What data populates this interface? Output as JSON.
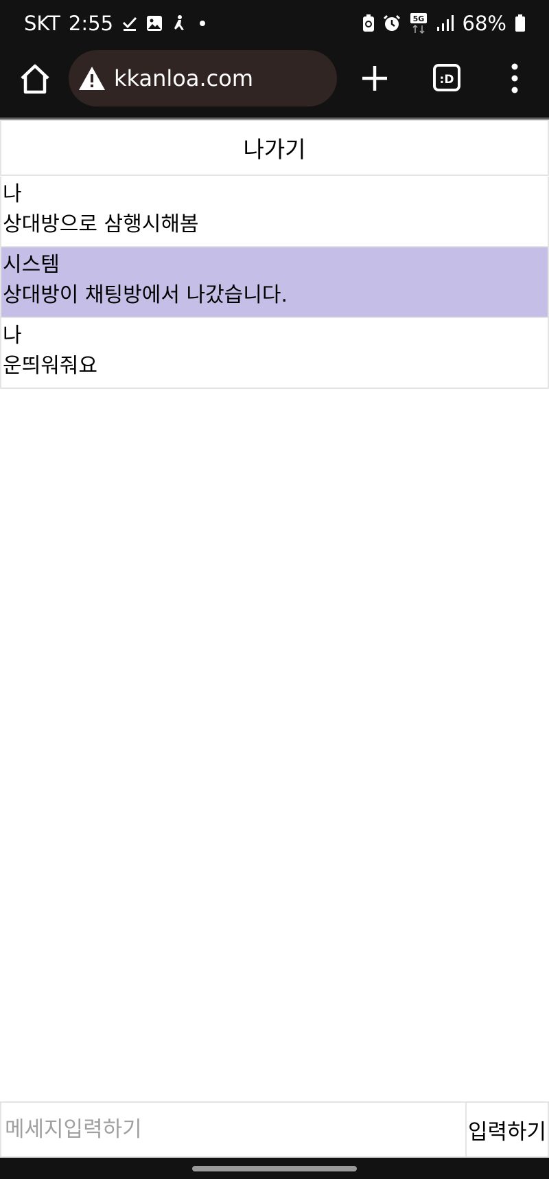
{
  "status_bar": {
    "carrier": "SKT",
    "time": "2:55",
    "battery": "68%",
    "network": "5G",
    "icons": [
      "check-icon",
      "image-icon",
      "accessibility-icon",
      "dot-icon",
      "battery-saver-icon",
      "alarm-icon",
      "network-5g-icon",
      "signal-icon",
      "battery-icon"
    ]
  },
  "browser": {
    "url": "kkanloa.com",
    "tabs_label": ":D"
  },
  "chat": {
    "exit_label": "나가기",
    "messages": [
      {
        "sender": "나",
        "text": "상대방으로 삼행시해봄",
        "type": "me"
      },
      {
        "sender": "시스템",
        "text": "상대방이 채팅방에서 나갔습니다.",
        "type": "system"
      },
      {
        "sender": "나",
        "text": "운띄워줘요",
        "type": "me"
      }
    ],
    "input_placeholder": "메세지입력하기",
    "send_label": "입력하기"
  },
  "colors": {
    "system_bg": "#c5bee6",
    "bar_bg": "#121212",
    "url_bg": "#302522"
  }
}
